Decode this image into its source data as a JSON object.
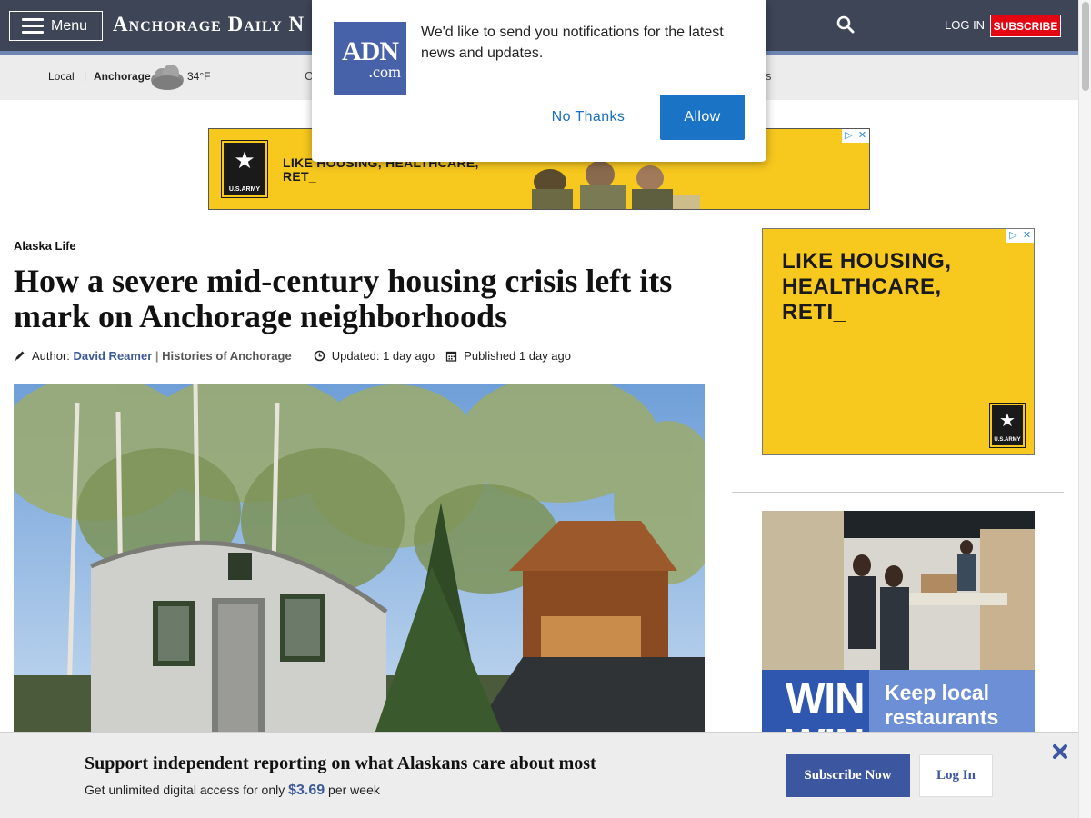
{
  "header": {
    "menu_label": "Menu",
    "logo_text": "Anchorage Daily N",
    "login_label": "LOG IN",
    "subscribe_label": "SUBSCRIBE"
  },
  "subnav": {
    "local": "Local",
    "separator": "|",
    "city": "Anchorage",
    "temperature": "34°F",
    "partial_left": "C",
    "partial_right": "s"
  },
  "ads": {
    "top_text": "LIKE HOUSING, HEALTHCARE,\nRET_",
    "side_text": "LIKE HOUSING,\nHEALTHCARE,\nRETI_",
    "army_text": "U.S.ARMY",
    "adchoice_play": "▷",
    "adchoice_close": "✕",
    "win_big": "WIN\nWIN",
    "win_copy": "Keep local\nrestaurants"
  },
  "article": {
    "section": "Alaska Life",
    "headline": "How a severe mid-century housing crisis left its mark on Anchorage neighborhoods",
    "author_prefix": "Author:",
    "author_name": "David Reamer",
    "pipe": "|",
    "series": "Histories of Anchorage",
    "updated": "Updated: 1 day ago",
    "published": "Published 1 day ago"
  },
  "notification": {
    "logo_big": "ADN",
    "logo_small": ".com",
    "message": "We'd like to send you notifications for the latest news and updates.",
    "no_label": "No Thanks",
    "allow_label": "Allow"
  },
  "bottom_bar": {
    "title": "Support independent reporting on what Alaskans care about most",
    "sub_prefix": "Get unlimited digital access for only",
    "price": "$3.69",
    "sub_suffix": "per week",
    "subscribe_label": "Subscribe Now",
    "login_label": "Log In"
  },
  "colors": {
    "header_bg": "#3d4557",
    "accent": "#3d5a98",
    "subscribe_red": "#e30613",
    "army_yellow": "#f7c81e",
    "allow_blue": "#1a73c5"
  },
  "icons": [
    "menu-icon",
    "search-icon",
    "cloud-icon",
    "pencil-icon",
    "clock-icon",
    "calendar-icon",
    "star-icon",
    "close-icon"
  ]
}
